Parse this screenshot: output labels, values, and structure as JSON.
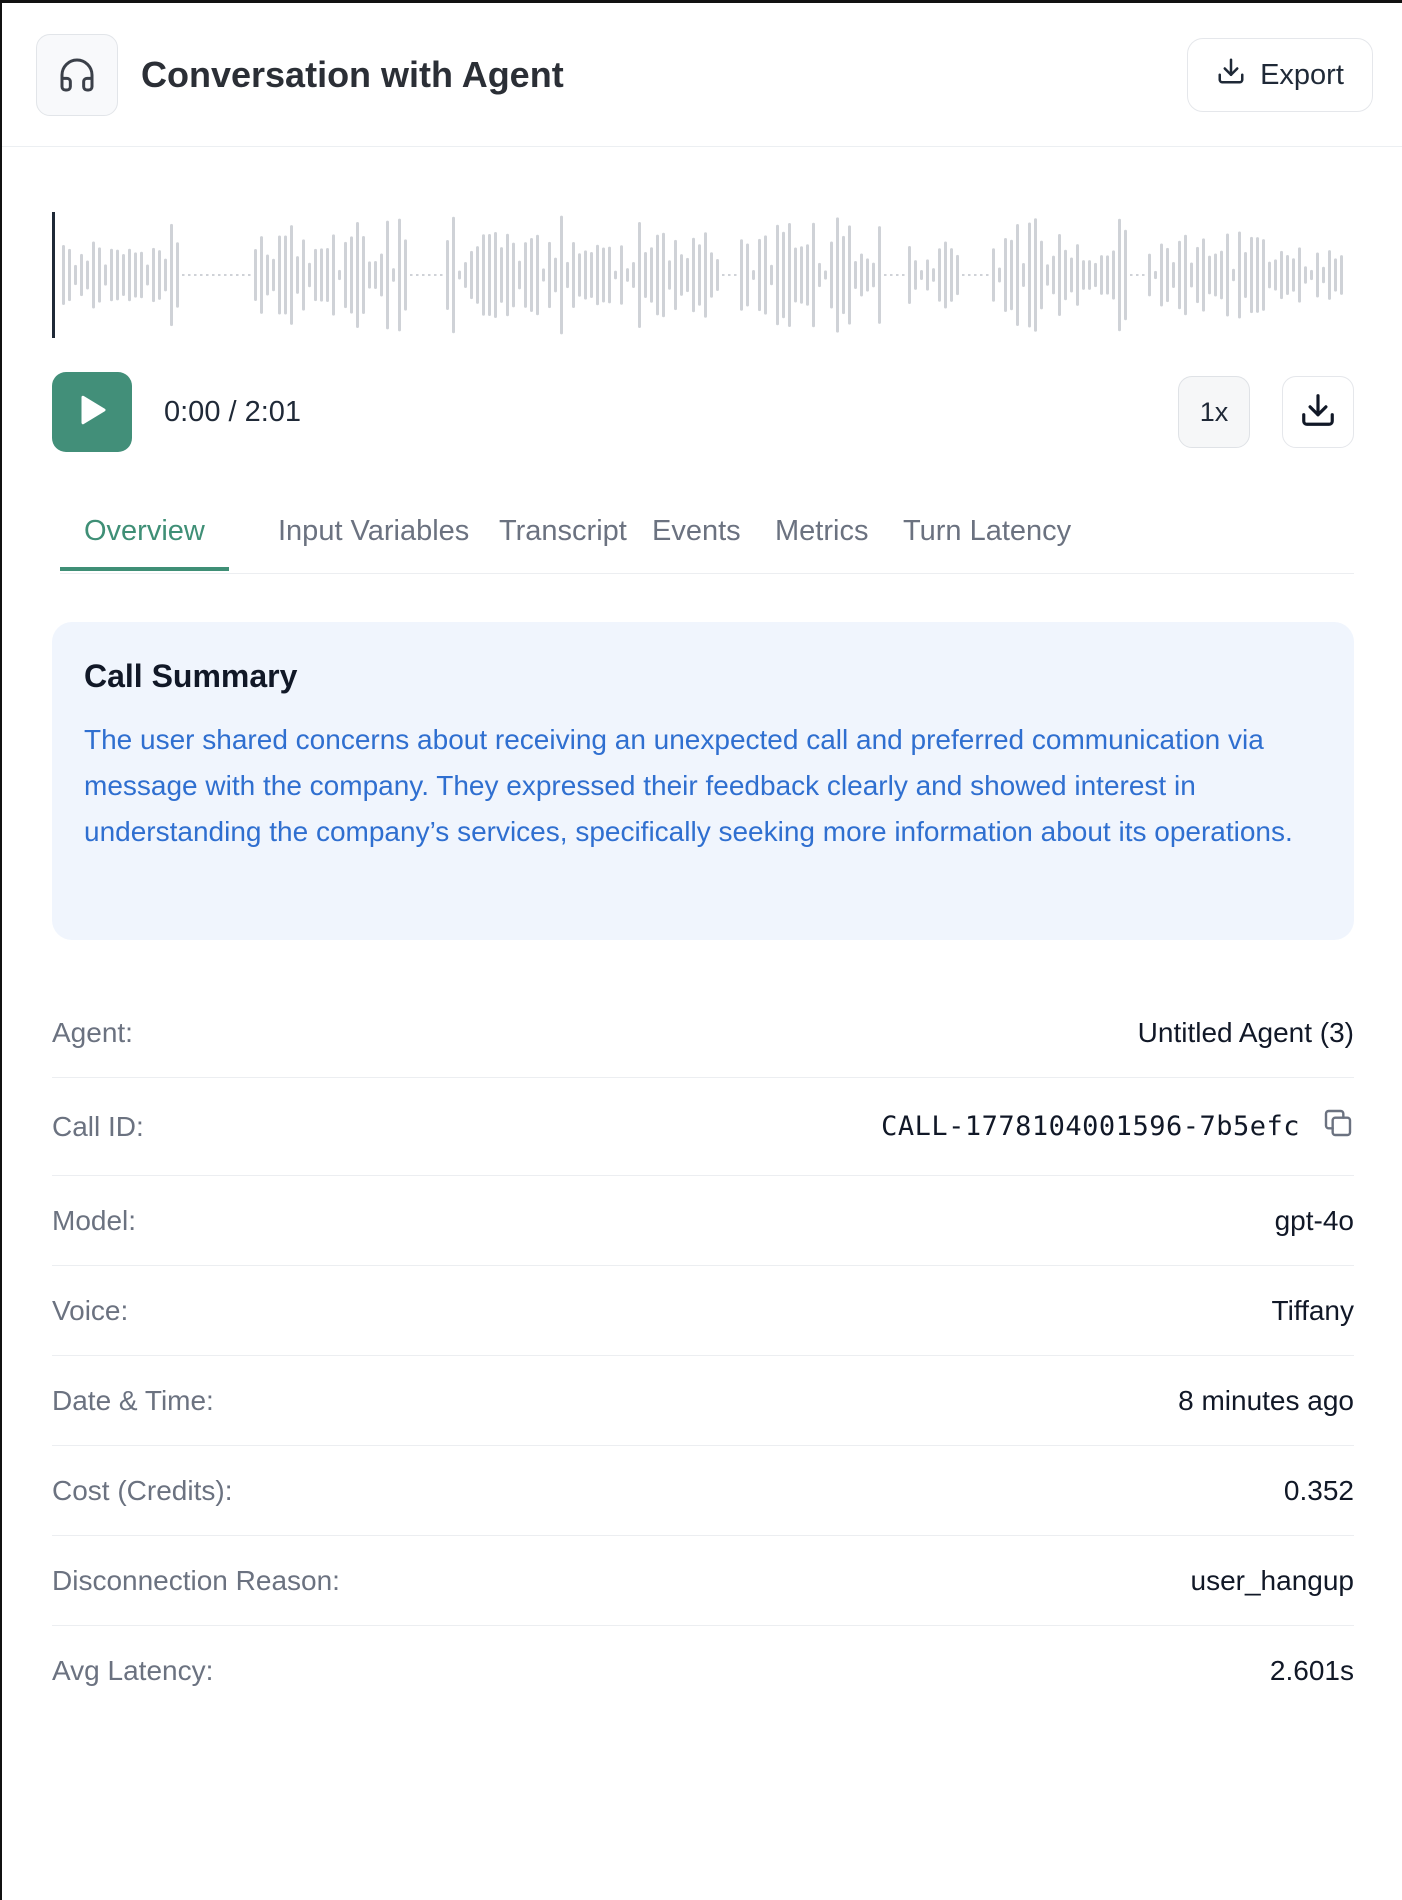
{
  "header": {
    "title": "Conversation with Agent",
    "export_label": "Export",
    "icon": "headphones-icon"
  },
  "player": {
    "time_display": "0:00 / 2:01",
    "speed_label": "1x",
    "progress": 0.0
  },
  "tabs": [
    {
      "label": "Overview",
      "active": true
    },
    {
      "label": "Input Variables",
      "active": false
    },
    {
      "label": "Transcript",
      "active": false
    },
    {
      "label": "Events",
      "active": false
    },
    {
      "label": "Metrics",
      "active": false
    },
    {
      "label": "Turn Latency",
      "active": false
    }
  ],
  "summary": {
    "title": "Call Summary",
    "text": "The user shared concerns about receiving an unexpected call and preferred communication via message with the company. They expressed their feedback clearly and showed interest in understanding the company’s services, specifically seeking more information about its operations."
  },
  "details": [
    {
      "label": "Agent:",
      "value": "Untitled Agent (3)"
    },
    {
      "label": "Call ID:",
      "value": "CALL-1778104001596-7b5efc"
    },
    {
      "label": "Model:",
      "value": "gpt-4o"
    },
    {
      "label": "Voice:",
      "value": "Tiffany"
    },
    {
      "label": "Date & Time:",
      "value": "8 minutes ago"
    },
    {
      "label": "Cost (Credits):",
      "value": "0.352"
    },
    {
      "label": "Disconnection Reason:",
      "value": "user_hangup"
    },
    {
      "label": "Avg Latency:",
      "value": "2.601s"
    }
  ],
  "colors": {
    "accent": "#428f79",
    "tab_active": "#3f8f76",
    "summary_bg": "#f0f5fd",
    "summary_text": "#2f6fd0",
    "waveform": "#cfd2d7"
  }
}
